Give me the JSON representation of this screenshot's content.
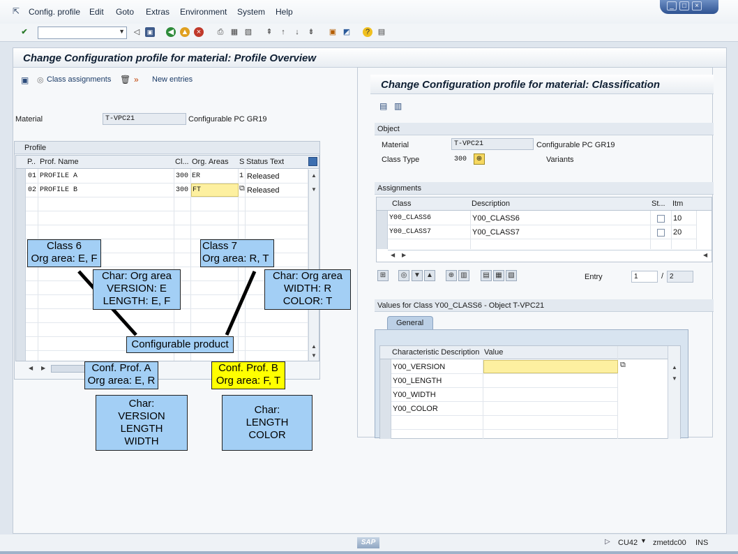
{
  "menu": {
    "items": [
      "Config. profile",
      "Edit",
      "Goto",
      "Extras",
      "Environment",
      "System",
      "Help"
    ]
  },
  "window_controls": {
    "minimize": "_",
    "maximize": "□",
    "close": "×"
  },
  "main": {
    "title": "Change Configuration profile for material: Profile Overview",
    "toolbar": {
      "class_assignments": "Class assignments",
      "new_entries": "New entries"
    },
    "material_label": "Material",
    "material_value": "T-VPC21",
    "material_desc": "Configurable PC GR19",
    "profile_group": "Profile",
    "profile_cols": {
      "p": "P..",
      "name": "Prof. Name",
      "cl": "Cl...",
      "org": "Org. Areas",
      "s": "S",
      "status": "Status Text"
    },
    "profiles": [
      {
        "p": "01",
        "name": "PROFILE A",
        "cl": "300",
        "org": "ER",
        "s": "1",
        "status": "Released"
      },
      {
        "p": "02",
        "name": "PROFILE B",
        "cl": "300",
        "org": "FT",
        "s": "",
        "status": "Released"
      }
    ]
  },
  "classification": {
    "title": "Change Configuration profile for material: Classification",
    "object_group": "Object",
    "material_label": "Material",
    "material_value": "T-VPC21",
    "material_desc": "Configurable PC GR19",
    "class_type_label": "Class Type",
    "class_type_value": "300",
    "variants_label": "Variants",
    "assignments_group": "Assignments",
    "assign_cols": {
      "class": "Class",
      "desc": "Description",
      "st": "St...",
      "itm": "Itm"
    },
    "assignments": [
      {
        "class": "Y00_CLASS6",
        "desc": "Y00_CLASS6",
        "itm": "10"
      },
      {
        "class": "Y00_CLASS7",
        "desc": "Y00_CLASS7",
        "itm": "20"
      }
    ],
    "entry_label": "Entry",
    "entry_value": "1",
    "entry_sep": "/",
    "entry_total": "2",
    "values_group": "Values for Class Y00_CLASS6 - Object T-VPC21",
    "tab_general": "General",
    "char_cols": {
      "desc": "Characteristic Description",
      "value": "Value"
    },
    "characteristics": [
      "Y00_VERSION",
      "Y00_LENGTH",
      "Y00_WIDTH",
      "Y00_COLOR"
    ]
  },
  "annotations": {
    "class6": [
      "Class 6",
      "Org area: E, F"
    ],
    "class7": [
      "Class 7",
      "Org area: R, T"
    ],
    "char_left": [
      "Char: Org area",
      "VERSION:   E",
      "LENGTH:   E, F"
    ],
    "char_right": [
      "Char: Org area",
      "WIDTH:   R",
      "COLOR:   T"
    ],
    "product": "Configurable product",
    "prof_a": [
      "Conf. Prof. A",
      "Org area: E, R"
    ],
    "prof_b": [
      "Conf. Prof. B",
      "Org area: F, T"
    ],
    "char_a": [
      "Char:",
      "VERSION",
      "LENGTH",
      "WIDTH"
    ],
    "char_b": [
      "Char:",
      "LENGTH",
      "COLOR"
    ]
  },
  "status": {
    "tcode": "CU42",
    "server": "zmetdc00",
    "mode": "INS",
    "logo": "SAP"
  },
  "colors": {
    "note_blue": "#a3cff5",
    "note_yellow": "#ffff00",
    "input_yellow": "#fdf0a0"
  }
}
